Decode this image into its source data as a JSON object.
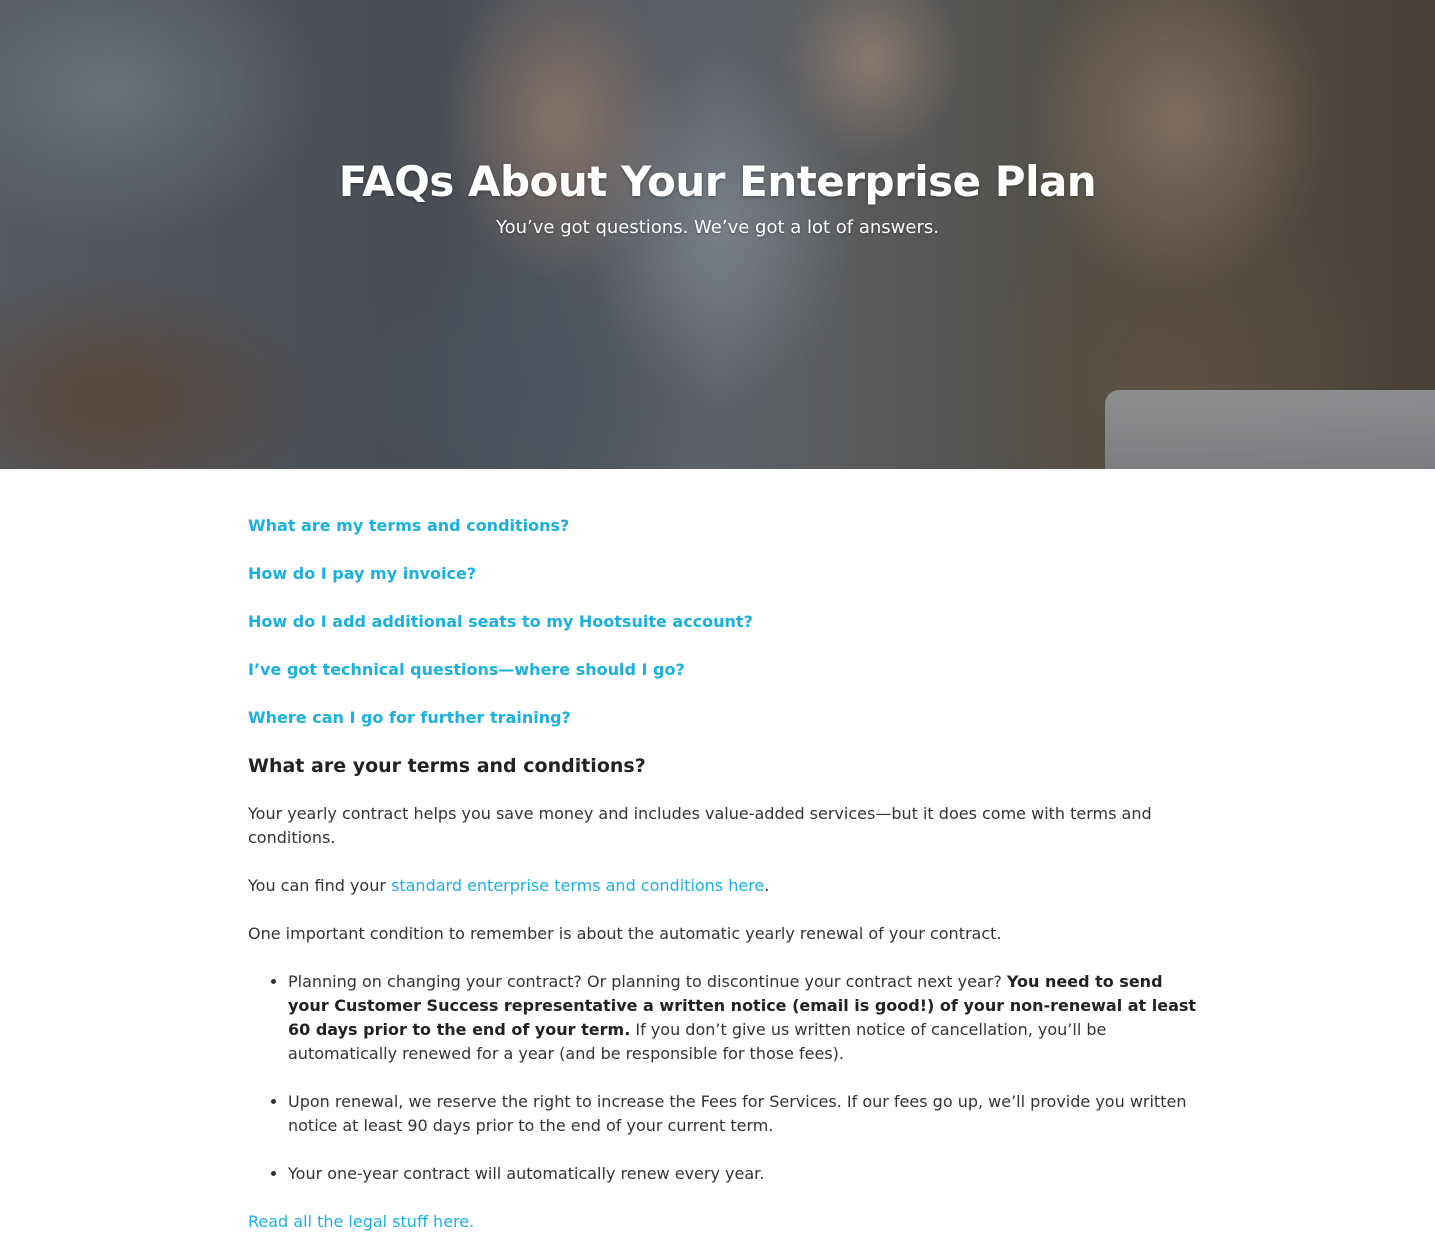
{
  "hero": {
    "title": "FAQs About Your Enterprise Plan",
    "subtitle": "You’ve got questions. We’ve got a lot of answers."
  },
  "faq_links": [
    "What are my terms and conditions?",
    "How do I pay my invoice?",
    "How do I add additional seats to my Hootsuite account?",
    "I’ve got technical questions—where should I go?",
    "Where can I go for further training?"
  ],
  "section": {
    "title": "What are your terms and conditions?",
    "para1": "Your yearly contract helps you save money and includes value-added services—but it does come with terms and conditions.",
    "para2_prefix": "You can find your ",
    "para2_link": "standard enterprise terms and conditions here",
    "para2_suffix": ".",
    "para3": "One important condition to remember is about the automatic yearly renewal of your contract.",
    "bullets": [
      {
        "before": "Planning on changing your contract? Or planning to discontinue your contract next year? ",
        "bold": "You need to send your Customer Success representative a written notice (email is good!) of your non-renewal at least 60 days prior to the end of your term.",
        "after": " If you don’t give us written notice of cancellation, you’ll be automatically renewed for a year (and be responsible for those fees)."
      },
      {
        "text": "Upon renewal, we reserve the right to increase the Fees for Services. If our fees go up, we’ll provide you written notice at least 90 days prior to the end of your current term."
      },
      {
        "text": "Your one-year contract will automatically renew every year."
      }
    ],
    "legal_link": "Read all the legal stuff here."
  },
  "colors": {
    "link": "#1ab0e0",
    "heading": "#222222",
    "body_text": "#333333",
    "hero_text": "#ffffff"
  }
}
